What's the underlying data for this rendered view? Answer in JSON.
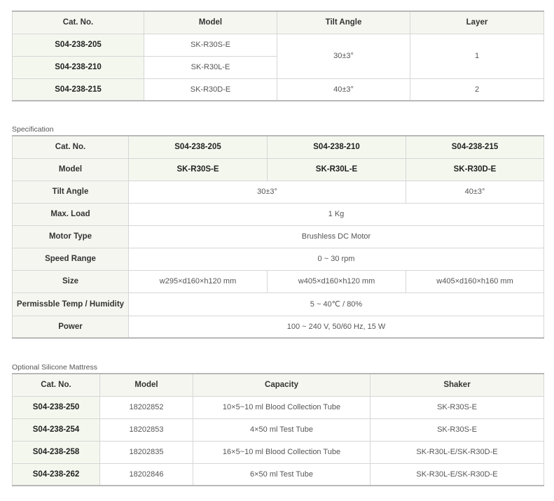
{
  "table1": {
    "headers": [
      "Cat. No.",
      "Model",
      "Tilt Angle",
      "Layer"
    ],
    "rows": [
      {
        "cat": "S04-238-205",
        "model": "SK-R30S-E"
      },
      {
        "cat": "S04-238-210",
        "model": "SK-R30L-E"
      },
      {
        "cat": "S04-238-215",
        "model": "SK-R30D-E"
      }
    ],
    "tilt_1": "30±3°",
    "layer_1": "1",
    "tilt_2": "40±3°",
    "layer_2": "2"
  },
  "spec": {
    "caption": "Specification",
    "labels": {
      "cat": "Cat. No.",
      "model": "Model",
      "tilt": "Tilt Angle",
      "load": "Max. Load",
      "motor": "Motor Type",
      "speed": "Speed Range",
      "size": "Size",
      "temp": "Permissble Temp / Humidity",
      "power": "Power"
    },
    "cats": [
      "S04-238-205",
      "S04-238-210",
      "S04-238-215"
    ],
    "models": [
      "SK-R30S-E",
      "SK-R30L-E",
      "SK-R30D-E"
    ],
    "tilt_a": "30±3°",
    "tilt_b": "40±3°",
    "load": "1 Kg",
    "motor": "Brushless DC Motor",
    "speed": "0 ~ 30 rpm",
    "sizes": [
      "w295×d160×h120 mm",
      "w405×d160×h120 mm",
      "w405×d160×h160 mm"
    ],
    "temp": "5 ~ 40℃ / 80%",
    "power": "100 ~ 240 V, 50/60 Hz, 15 W"
  },
  "mattress": {
    "caption": "Optional Silicone Mattress",
    "headers": [
      "Cat. No.",
      "Model",
      "Capacity",
      "Shaker"
    ],
    "rows": [
      {
        "cat": "S04-238-250",
        "model": "18202852",
        "capacity": "10×5~10 ml Blood Collection Tube",
        "shaker": "SK-R30S-E"
      },
      {
        "cat": "S04-238-254",
        "model": "18202853",
        "capacity": "4×50 ml Test Tube",
        "shaker": "SK-R30S-E"
      },
      {
        "cat": "S04-238-258",
        "model": "18202835",
        "capacity": "16×5~10 ml Blood Collection Tube",
        "shaker": "SK-R30L-E/SK-R30D-E"
      },
      {
        "cat": "S04-238-262",
        "model": "18202846",
        "capacity": "6×50 ml Test Tube",
        "shaker": "SK-R30L-E/SK-R30D-E"
      }
    ]
  }
}
